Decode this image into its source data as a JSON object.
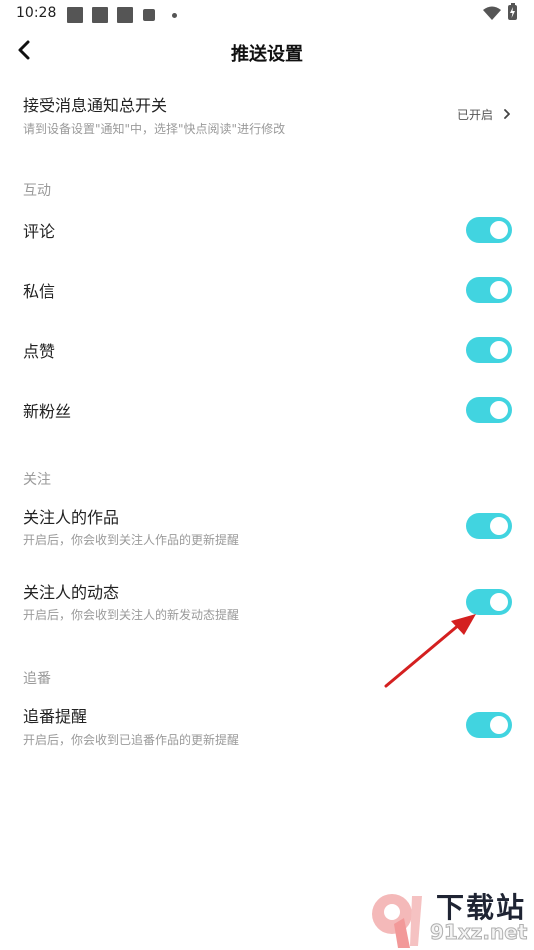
{
  "status_bar": {
    "time": "10:28",
    "icons": [
      "notification-icon",
      "notification-icon",
      "notification-icon",
      "notification-icon",
      "more-dot-icon",
      "wifi-icon",
      "battery-charging-icon"
    ]
  },
  "header": {
    "title": "推送设置",
    "back_icon": "chevron-left-icon"
  },
  "master": {
    "title": "接受消息通知总开关",
    "subtitle": "请到设备设置\"通知\"中，选择\"快点阅读\"进行修改",
    "value": "已开启",
    "chevron_icon": "chevron-right-icon"
  },
  "sections": [
    {
      "title": "互动",
      "items": [
        {
          "label": "评论",
          "enabled": true
        },
        {
          "label": "私信",
          "enabled": true
        },
        {
          "label": "点赞",
          "enabled": true
        },
        {
          "label": "新粉丝",
          "enabled": true
        }
      ]
    },
    {
      "title": "关注",
      "items": [
        {
          "label": "关注人的作品",
          "subtitle": "开启后，你会收到关注人作品的更新提醒",
          "enabled": true
        },
        {
          "label": "关注人的动态",
          "subtitle": "开启后，你会收到关注人的新发动态提醒",
          "enabled": true
        }
      ]
    },
    {
      "title": "追番",
      "items": [
        {
          "label": "追番提醒",
          "subtitle": "开启后，你会收到已追番作品的更新提醒",
          "enabled": true
        }
      ]
    }
  ],
  "colors": {
    "toggle_on": "#41d4e0",
    "annotation_arrow": "#d42020"
  },
  "watermark": {
    "logo_text": "9",
    "text_top": "下载站",
    "text_bottom": "91xz.net"
  }
}
